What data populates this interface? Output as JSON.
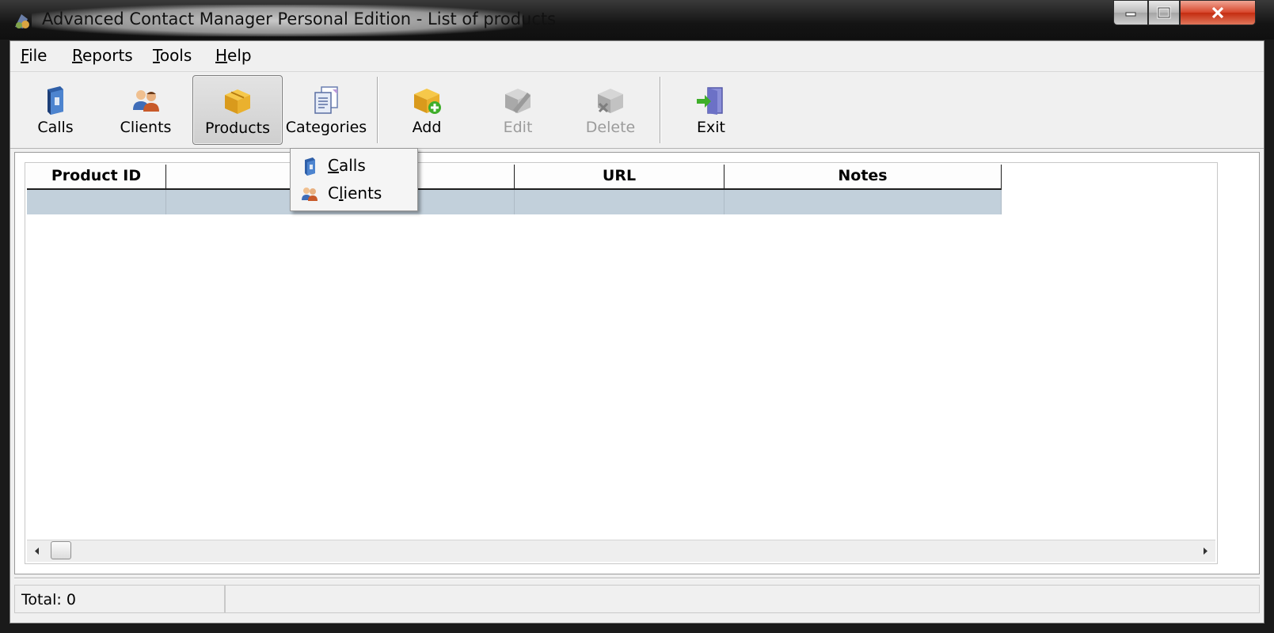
{
  "window": {
    "title": "Advanced Contact Manager Personal Edition - List of products"
  },
  "menu": {
    "file": {
      "accel": "F",
      "rest": "ile"
    },
    "reports": {
      "accel": "R",
      "rest": "eports"
    },
    "tools": {
      "accel": "T",
      "rest": "ools"
    },
    "help": {
      "accel": "H",
      "rest": "elp"
    }
  },
  "toolbar": {
    "calls": "Calls",
    "clients": "Clients",
    "products": "Products",
    "categories": "Categories",
    "add": "Add",
    "edit": "Edit",
    "delete": "Delete",
    "exit": "Exit",
    "active_item": "Products",
    "disabled_items": [
      "Edit",
      "Delete"
    ]
  },
  "table": {
    "columns": [
      "Product ID",
      "",
      "URL",
      "Notes"
    ],
    "rows": [
      [
        "",
        "",
        "",
        ""
      ]
    ]
  },
  "dropdown": {
    "items": [
      {
        "accel": "C",
        "rest": "alls",
        "icon": "calls-binder-icon"
      },
      {
        "pre": "C",
        "accel": "l",
        "rest": "ients",
        "icon": "clients-people-icon"
      }
    ]
  },
  "status": {
    "total": "Total: 0"
  },
  "colors": {
    "selected_row": "#c2d0db",
    "titlebar": "#141414",
    "close_button": "#c42c10"
  }
}
